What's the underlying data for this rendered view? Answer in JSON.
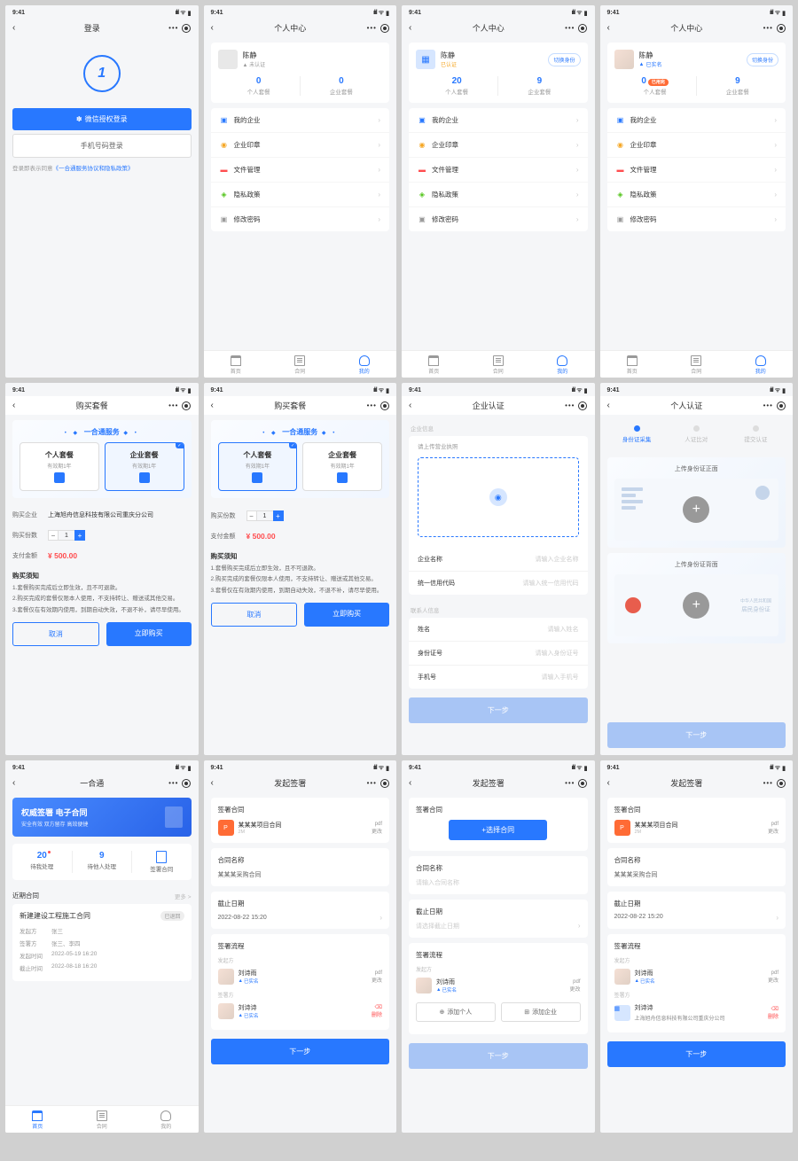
{
  "time": "9:41",
  "r1": {
    "s1": {
      "title": "登录",
      "btn_wechat": "微信授权登录",
      "btn_phone": "手机号码登录",
      "hint_prefix": "登录即表示同意",
      "hint_link": "《一合通服务协议和隐私政策》"
    },
    "s2": {
      "title": "个人中心",
      "name": "陈静",
      "sub": "未认证",
      "c1n": "0",
      "c1l": "个人套餐",
      "c2n": "0",
      "c2l": "企业套餐"
    },
    "s3": {
      "title": "个人中心",
      "name": "陈静",
      "sub": "已认证",
      "switch": "切换身份",
      "c1n": "20",
      "c1l": "个人套餐",
      "c2n": "9",
      "c2l": "企业套餐"
    },
    "s4": {
      "title": "个人中心",
      "name": "陈静",
      "sub": "已实名",
      "switch": "切换身份",
      "c1n": "0",
      "c1l": "个人套餐",
      "pkg": "已用完",
      "c2n": "9",
      "c2l": "企业套餐"
    }
  },
  "menu": {
    "m1": "我的企业",
    "m2": "企业印章",
    "m3": "文件管理",
    "m4": "隐私政策",
    "m5": "修改密码"
  },
  "tabs": {
    "t1": "首页",
    "t2": "合同",
    "t3": "我的"
  },
  "r2": {
    "s1": {
      "title": "购买套餐",
      "svc": "一合通服务",
      "p1": "个人套餐",
      "p1s": "有效期1年",
      "p2": "企业套餐",
      "p2s": "有效期1年",
      "corp_label": "购买企业",
      "corp": "上海旭舟信息科技有限公司重庆分公司",
      "qty_label": "购买份数",
      "qty": "1",
      "amt_label": "支付金额",
      "amt": "¥ 500.00",
      "notice_title": "购买须知",
      "n1": "1.套餐购买完成后立即生效，且不可退款。",
      "n2": "2.购买完成的套餐仅限本人使用，不支持转让、赠送或其他交易。",
      "n3": "3.套餐仅在有效期内使用，到期自动失效，不退不补，请尽早使用。",
      "btn_cancel": "取消",
      "btn_buy": "立即购买"
    },
    "s3": {
      "title": "企业认证",
      "grp1": "企业信息",
      "upload": "请上传营业执照",
      "f1l": "企业名称",
      "f1p": "请输入企业名称",
      "f2l": "统一信用代码",
      "f2p": "请输入统一信用代码",
      "grp2": "联系人信息",
      "f3l": "姓名",
      "f3p": "请输入姓名",
      "f4l": "身份证号",
      "f4p": "请输入身份证号",
      "f5l": "手机号",
      "f5p": "请输入手机号",
      "btn": "下一步"
    },
    "s4": {
      "title": "个人认证",
      "step1": "身份证采集",
      "step2": "人证比对",
      "step3": "提交认证",
      "id_front": "上传身份证正面",
      "id_back": "上传身份证背面",
      "id_back_text": "居民身份证",
      "id_back_sub": "中华人民共和国",
      "btn": "下一步"
    }
  },
  "r3": {
    "s1": {
      "title": "一合通",
      "bn_title": "权威签署 电子合同",
      "bn_sub": "安全有效 双方留存 高效便捷",
      "st1n": "20",
      "st1l": "待我处理",
      "st2n": "9",
      "st2l": "待他人处理",
      "st3l": "签署合同",
      "sec": "近期合同",
      "more": "更多 >",
      "ci_title": "新建建设工程施工合同",
      "ci_badge": "已退回",
      "k1": "发起方",
      "v1": "张三",
      "k2": "签署方",
      "v2": "张三、李四",
      "k3": "发起时间",
      "v3": "2022-05-19 16:20",
      "k4": "截止时间",
      "v4": "2022-08-18 16:20"
    },
    "s2": {
      "title": "发起签署",
      "sc1": "签署合同",
      "file": "某某某项目合同",
      "fsize": "2M",
      "fact_lbl": "pdf",
      "fact": "更改",
      "sc2": "合同名称",
      "cname": "某某某采购合同",
      "sc3": "截止日期",
      "ddl": "2022-08-22 15:20",
      "sc4": "签署流程",
      "sig1": "发起方",
      "sn1": "刘诗雨",
      "ss1": "已实名",
      "sa1l": "pdf",
      "sa1": "更改",
      "sig2": "签署方",
      "sn2": "刘诗诗",
      "ss2": "已实名",
      "sa2": "删除",
      "btn": "下一步"
    },
    "s3": {
      "title": "发起签署",
      "sc1": "签署合同",
      "btn_select": "+选择合同",
      "sc2": "合同名称",
      "cname_ph": "请输入合同名称",
      "sc3": "截止日期",
      "ddl_ph": "请选择截止日期",
      "sc4": "签署流程",
      "sig1": "发起方",
      "sn1": "刘诗雨",
      "ss1": "已实名",
      "sa1": "更改",
      "add1": "添加个人",
      "add2": "添加企业",
      "btn": "下一步"
    },
    "s4": {
      "title": "发起签署",
      "sc1": "签署合同",
      "file": "某某某项目合同",
      "fsize": "2M",
      "fact": "更改",
      "sc2": "合同名称",
      "cname": "某某某采购合同",
      "sc3": "截止日期",
      "ddl": "2022-08-22 15:20",
      "sc4": "签署流程",
      "sig1": "发起方",
      "sn1": "刘诗雨",
      "ss1": "已实名",
      "sa1": "更改",
      "sig2": "签署方",
      "sn2": "刘诗诗",
      "sa2": "删除",
      "corp": "上海旭舟信息科技有限公司重庆分公司",
      "btn": "下一步"
    }
  }
}
